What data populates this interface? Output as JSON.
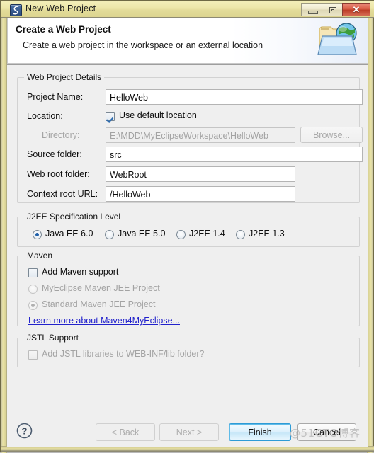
{
  "window": {
    "title": "New Web Project",
    "icon": "myeclipse-icon",
    "controls": {
      "minimize": "minimize-icon",
      "restore": "restore-icon",
      "close": "✕"
    }
  },
  "header": {
    "title": "Create a Web Project",
    "subtitle": "Create a web project in the workspace or an external location",
    "icon": "web-project-folder-globe-icon"
  },
  "web_project_details": {
    "legend": "Web Project Details",
    "project_name": {
      "label": "Project Name:",
      "value": "HelloWeb"
    },
    "location": {
      "label": "Location:",
      "checkbox_label": "Use default location",
      "checked": true
    },
    "directory": {
      "label": "Directory:",
      "value": "E:\\MDD\\MyEclipseWorkspace\\HelloWeb",
      "enabled": false
    },
    "browse_button": "Browse...",
    "source_folder": {
      "label": "Source folder:",
      "value": "src"
    },
    "web_root_folder": {
      "label": "Web root folder:",
      "value": "WebRoot"
    },
    "context_root_url": {
      "label": "Context root URL:",
      "value": "/HelloWeb"
    }
  },
  "j2ee_spec": {
    "legend": "J2EE Specification Level",
    "options": [
      {
        "label": "Java EE 6.0",
        "selected": true
      },
      {
        "label": "Java EE 5.0",
        "selected": false
      },
      {
        "label": "J2EE 1.4",
        "selected": false
      },
      {
        "label": "J2EE 1.3",
        "selected": false
      }
    ]
  },
  "maven": {
    "legend": "Maven",
    "add_support": {
      "label": "Add Maven support",
      "checked": false
    },
    "options": [
      {
        "label": "MyEclipse Maven JEE Project",
        "selected": false
      },
      {
        "label": "Standard Maven JEE Project",
        "selected": true
      }
    ],
    "link": "Learn more about Maven4MyEclipse..."
  },
  "jstl": {
    "legend": "JSTL Support",
    "add_libraries": {
      "label": "Add JSTL libraries to WEB-INF/lib folder?",
      "checked": false
    }
  },
  "footer": {
    "help_icon": "?",
    "back": "< Back",
    "next": "Next >",
    "finish": "Finish",
    "cancel": "Cancel"
  },
  "watermark": "@51CTO博客"
}
